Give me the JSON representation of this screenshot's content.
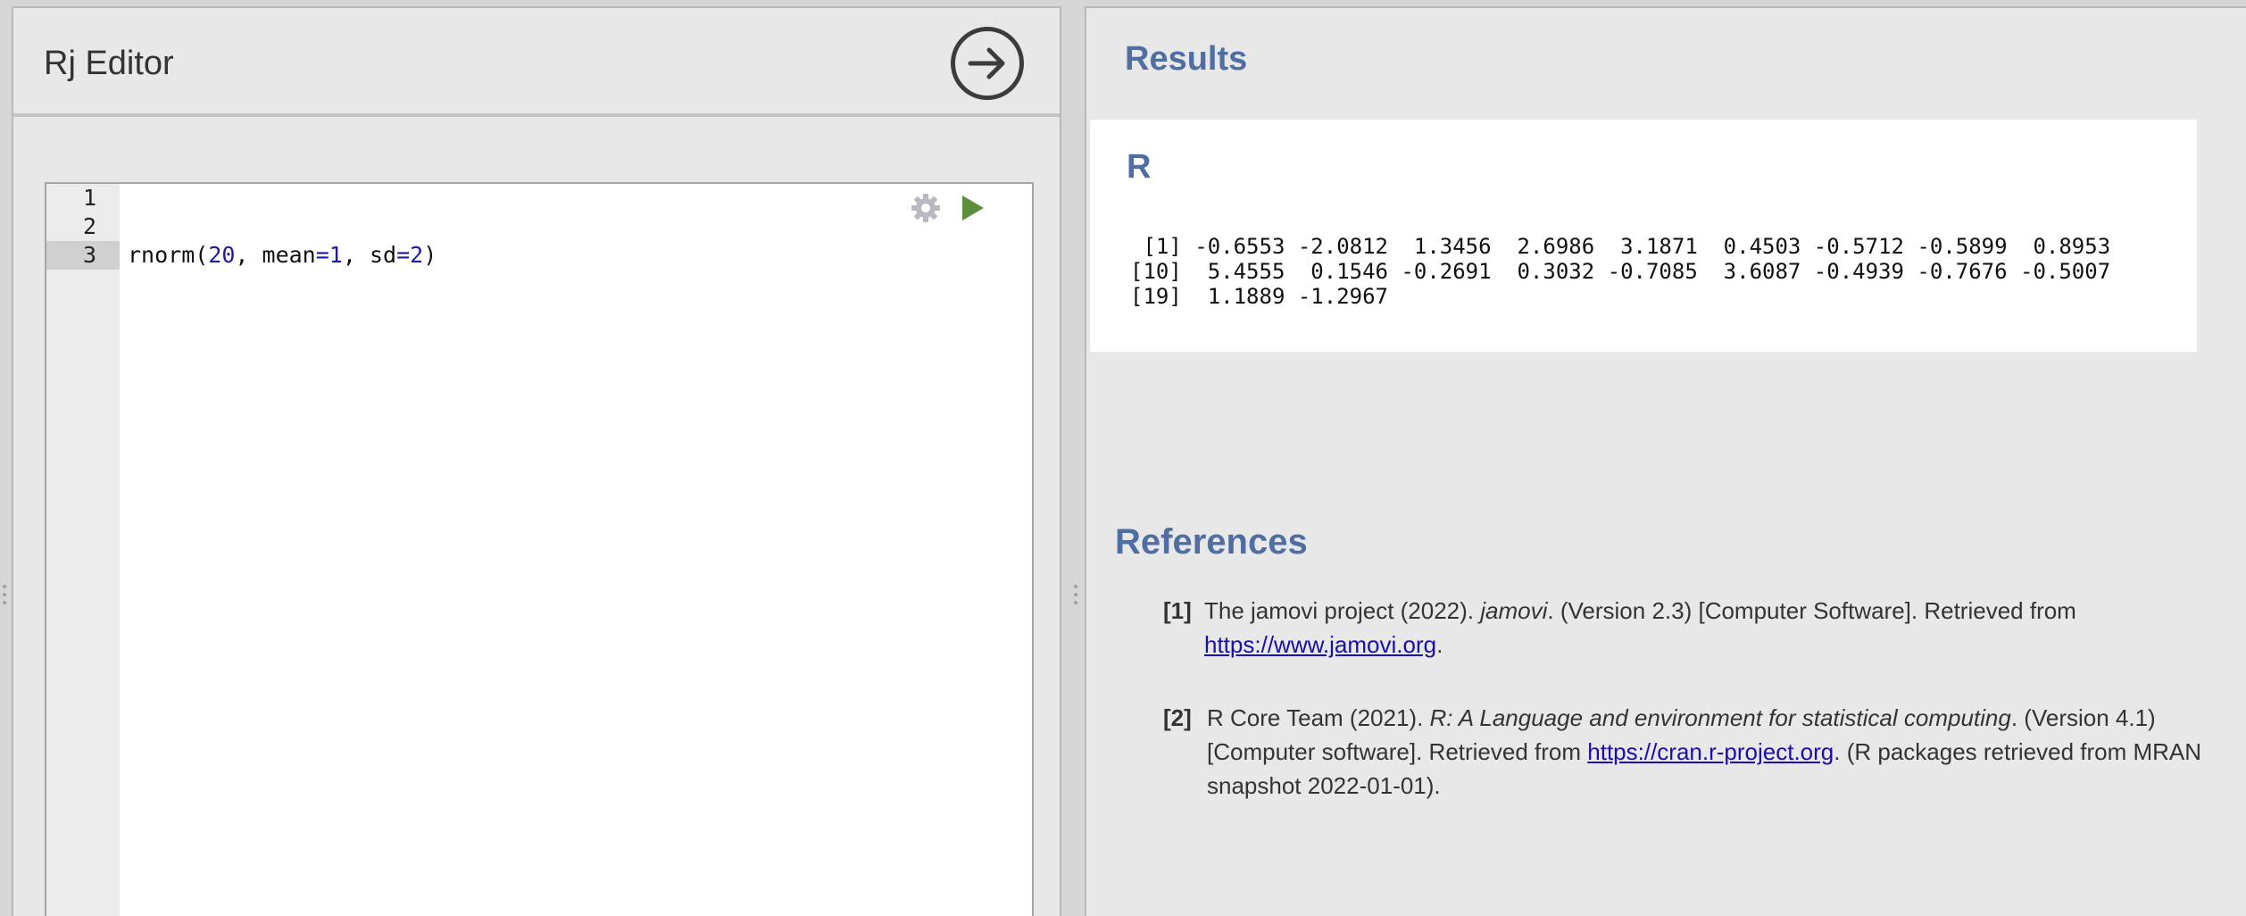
{
  "editor": {
    "title": "Rj Editor",
    "gutter": [
      "1",
      "2",
      "3"
    ],
    "code": {
      "fn": "rnorm(",
      "arg1": "20",
      "sep1": ", mean",
      "eq1": "=",
      "arg2": "1",
      "sep2": ", sd",
      "eq2": "=",
      "arg3": "2",
      "close": ")"
    }
  },
  "results": {
    "heading": "Results",
    "r_title": "R",
    "output_lines": [
      " [1] -0.6553 -2.0812  1.3456  2.6986  3.1871  0.4503 -0.5712 -0.5899  0.8953",
      "[10]  5.4555  0.1546 -0.2691  0.3032 -0.7085  3.6087 -0.4939 -0.7676 -0.5007",
      "[19]  1.1889 -1.2967"
    ]
  },
  "references": {
    "heading": "References",
    "items": [
      {
        "num": "[1]",
        "pre": "The jamovi project (2022). ",
        "italic": "jamovi",
        "post": ". (Version 2.3) [Computer Software]. Retrieved from ",
        "link": "https://www.jamovi.org",
        "end": "."
      },
      {
        "num": "[2]",
        "pre": "R Core Team (2021). ",
        "italic": "R: A Language and environment for statistical computing",
        "post": ". (Version 4.1) [Computer software]. Retrieved from ",
        "link": "https://cran.r-project.org",
        "end": ". (R packages retrieved from MRAN snapshot 2022-01-01)."
      }
    ]
  },
  "colors": {
    "heading_blue": "#4f6ea3",
    "run_green": "#5a8f3c",
    "link_blue": "#1a0dab"
  },
  "icons": [
    "arrow-right-circle-icon",
    "gear-icon",
    "play-icon"
  ]
}
